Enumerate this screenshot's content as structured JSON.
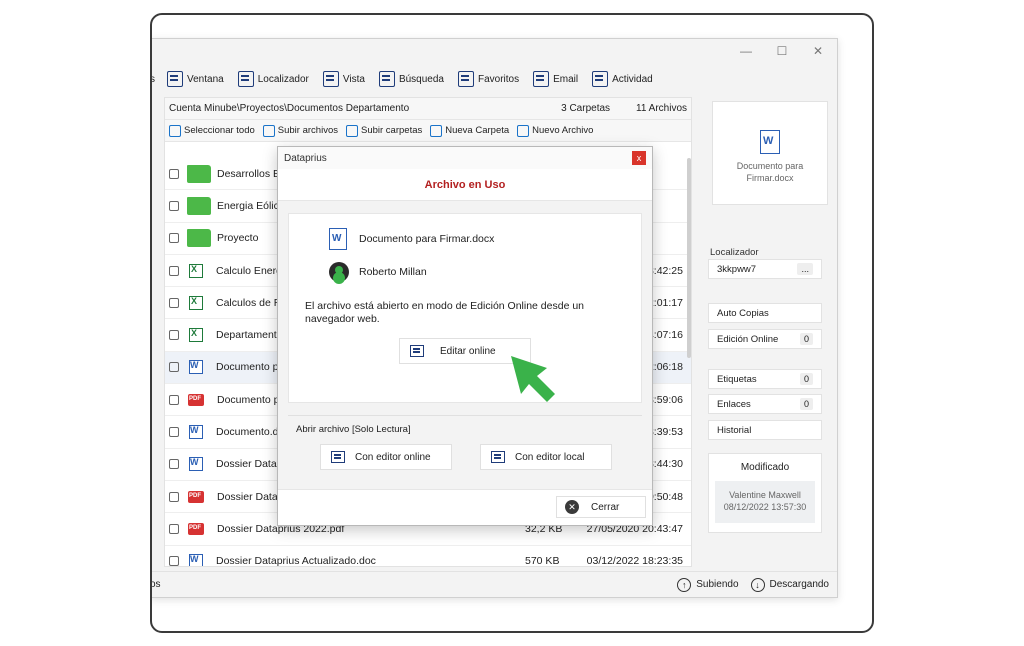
{
  "toolbar": {
    "items": [
      {
        "label": "s",
        "icon": "partial-icon"
      },
      {
        "label": "Ventana",
        "icon": "window-icon"
      },
      {
        "label": "Localizador",
        "icon": "locator-icon"
      },
      {
        "label": "Vista",
        "icon": "view-icon"
      },
      {
        "label": "Búsqueda",
        "icon": "search-icon"
      },
      {
        "label": "Favoritos",
        "icon": "favorites-icon"
      },
      {
        "label": "Email",
        "icon": "email-icon"
      },
      {
        "label": "Actividad",
        "icon": "activity-icon"
      }
    ]
  },
  "path": {
    "breadcrumb": "Cuenta Minube\\Proyectos\\Documentos Departamento",
    "folders": "3 Carpetas",
    "files": "11 Archivos"
  },
  "actions": {
    "select_all": "Seleccionar todo",
    "upload_files": "Subir archivos",
    "upload_folders": "Subir carpetas",
    "new_folder": "Nueva Carpeta",
    "new_file": "Nuevo Archivo"
  },
  "files": [
    {
      "name": "Desarrollos E",
      "type": "folder",
      "size": "",
      "date": ""
    },
    {
      "name": "Energia Eólica",
      "type": "folder",
      "size": "",
      "date": ""
    },
    {
      "name": "Proyecto",
      "type": "folder",
      "size": "",
      "date": ""
    },
    {
      "name": "Calculo Energ",
      "type": "xls",
      "size": "",
      "date": "3:42:25"
    },
    {
      "name": "Calculos de R",
      "type": "xls",
      "size": "",
      "date": "2:01:17"
    },
    {
      "name": "Departamento",
      "type": "xls",
      "size": "",
      "date": "4:07:16"
    },
    {
      "name": "Documento p",
      "type": "doc",
      "size": "",
      "date": "2:06:18"
    },
    {
      "name": "Documento p",
      "type": "pdf",
      "size": "",
      "date": "3:59:06"
    },
    {
      "name": "Documento.do",
      "type": "doc",
      "size": "",
      "date": "3:39:53"
    },
    {
      "name": "Dossier Datap",
      "type": "doc",
      "size": "",
      "date": "8:44:30"
    },
    {
      "name": "Dossier Datap",
      "type": "pdf",
      "size": "",
      "date": "9:50:48"
    },
    {
      "name": "Dossier Dataprius 2022.pdf",
      "type": "pdf",
      "size": "32,2 KB",
      "date": "27/05/2020 20:43:47"
    },
    {
      "name": "Dossier Dataprius Actualizado.doc",
      "type": "doc",
      "size": "570 KB",
      "date": "03/12/2022 18:23:35"
    }
  ],
  "side": {
    "preview_name": "Documento para Firmar.docx",
    "locator_label": "Localizador",
    "locator_value": "3kkpww7",
    "locator_more": "...",
    "auto_copias": "Auto Copias",
    "edicion_online": "Edición Online",
    "edicion_count": "0",
    "etiquetas": "Etiquetas",
    "etiquetas_count": "0",
    "enlaces": "Enlaces",
    "enlaces_count": "0",
    "historial": "Historial",
    "modified_label": "Modificado",
    "modified_by": "Valentine Maxwell",
    "modified_date": "08/12/2022 13:57:30"
  },
  "status": {
    "left": "os",
    "uploading": "Subiendo",
    "downloading": "Descargando"
  },
  "dialog": {
    "title": "Dataprius",
    "close": "x",
    "heading": "Archivo en Uso",
    "file_name": "Documento para Firmar.docx",
    "user": "Roberto Millan",
    "message": "El archivo está abierto en modo de Edición Online desde un navegador web.",
    "edit_online": "Editar online",
    "readonly_label": "Abrir archivo [Solo Lectura]",
    "open_online": "Con editor online",
    "open_local": "Con editor local",
    "cancel": "Cerrar"
  },
  "colors": {
    "accent_red": "#b32020",
    "folder_green": "#4cb848",
    "arrow_green": "#3ab24a"
  }
}
